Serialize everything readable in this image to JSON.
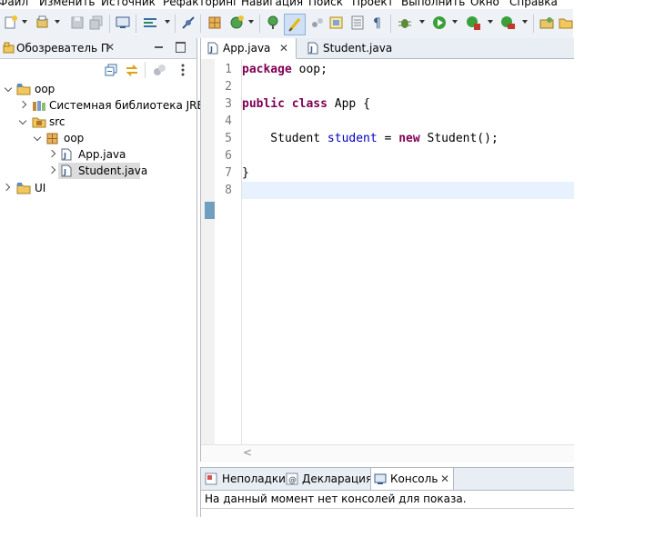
{
  "menu": [
    "Файл",
    "Изменить",
    "Источник",
    "Рефакторинг",
    "Навигация",
    "Поиск",
    "Проект",
    "Выполнить",
    "Окно",
    "Справка"
  ],
  "explorer": {
    "title": "Обозреватель П",
    "tree": [
      {
        "label": "oop",
        "icon": "project-folder-icon"
      },
      {
        "label": "Системная библиотека JRE [J",
        "icon": "library-icon"
      },
      {
        "label": "src",
        "icon": "source-folder-icon"
      },
      {
        "label": "oop",
        "icon": "package-icon"
      },
      {
        "label": "App.java",
        "icon": "java-file-icon"
      },
      {
        "label": "Student.java",
        "icon": "java-file-icon"
      },
      {
        "label": "UI",
        "icon": "project-folder-icon"
      }
    ]
  },
  "editor": {
    "tabs": [
      {
        "label": "App.java",
        "active": true
      },
      {
        "label": "Student.java",
        "active": false
      }
    ],
    "line_numbers": [
      "1",
      "2",
      "3",
      "4",
      "5",
      "6",
      "7",
      "8"
    ],
    "code": {
      "line1": {
        "kw": "package",
        "rest": " oop;"
      },
      "line3": {
        "kw1": "public",
        "kw2": "class",
        "rest": " App {"
      },
      "line5": {
        "type": "    Student ",
        "var": "student",
        "eq": " = ",
        "kw": "new",
        "rest": " Student();"
      },
      "line7": "}"
    },
    "scroll_arrow": "<"
  },
  "console": {
    "tabs": [
      {
        "label": "Неполадки",
        "active": false
      },
      {
        "label": "Декларация",
        "active": false
      },
      {
        "label": "Консоль",
        "active": true
      }
    ],
    "message": "На данный момент нет консолей для показа."
  },
  "colors": {
    "keyword": "#7f0055",
    "field": "#0000c0",
    "current_line": "#e8f2fe"
  }
}
